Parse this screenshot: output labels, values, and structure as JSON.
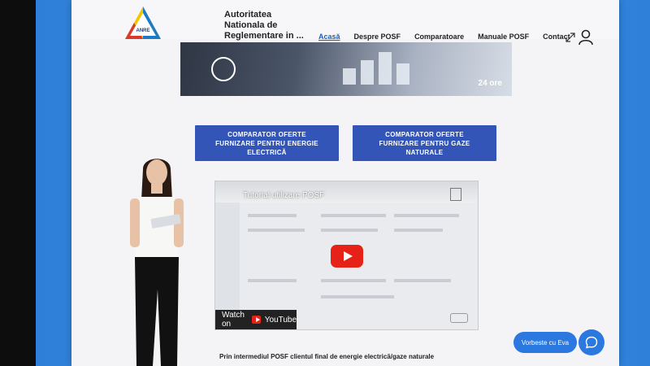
{
  "header": {
    "logo_text": "ANRE",
    "org_name": "Autoritatea Nationala de Reglementare in ... Energiei",
    "nav": [
      "Acasă",
      "Despre POSF",
      "Comparatoare",
      "Manuale POSF",
      "Contact"
    ]
  },
  "banner": {
    "year_text": "24 ore"
  },
  "comparators": [
    {
      "label": "COMPARATOR OFERTE FURNIZARE PENTRU ENERGIE ELECTRICĂ"
    },
    {
      "label": "COMPARATOR OFERTE FURNIZARE PENTRU GAZE NATURALE"
    }
  ],
  "video": {
    "title": "Tutorial utilizare POSF",
    "watch_on": "Watch on",
    "youtube": "YouTube"
  },
  "intro_text": "Prin intermediul POSF clientul final de energie electrică/gaze naturale",
  "chat": {
    "label": "Vorbeste cu Eva"
  },
  "colors": {
    "button_blue": "#3355b8",
    "chat_blue": "#2a78e0",
    "studio_blue": "#3b8fe6"
  }
}
